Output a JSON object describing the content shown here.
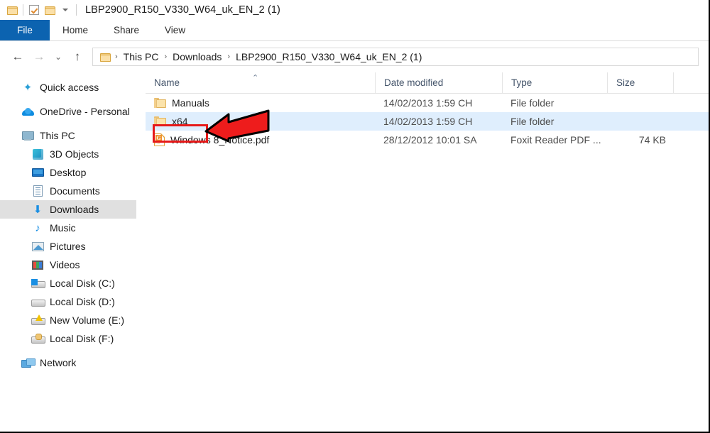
{
  "window": {
    "title": "LBP2900_R150_V330_W64_uk_EN_2 (1)",
    "quick_access_icons": [
      "folder-icon",
      "properties-checkbox-icon",
      "new-folder-icon",
      "customize-chevron-icon"
    ]
  },
  "ribbon": {
    "tabs": [
      {
        "label": "File",
        "active": true
      },
      {
        "label": "Home",
        "active": false
      },
      {
        "label": "Share",
        "active": false
      },
      {
        "label": "View",
        "active": false
      }
    ]
  },
  "navbar": {
    "back": "←",
    "forward": "→",
    "recent": "⌄",
    "up": "↑",
    "breadcrumb": [
      "This PC",
      "Downloads",
      "LBP2900_R150_V330_W64_uk_EN_2 (1)"
    ],
    "separator": "›"
  },
  "sidebar": {
    "items": [
      {
        "label": "Quick access",
        "icon": "star-icon",
        "indent": 0,
        "selected": false
      },
      {
        "label": "OneDrive - Personal",
        "icon": "onedrive-cloud-icon",
        "indent": 0,
        "selected": false
      },
      {
        "label": "This PC",
        "icon": "this-pc-icon",
        "indent": 0,
        "selected": false
      },
      {
        "label": "3D Objects",
        "icon": "3d-objects-icon",
        "indent": 1,
        "selected": false
      },
      {
        "label": "Desktop",
        "icon": "desktop-icon",
        "indent": 1,
        "selected": false
      },
      {
        "label": "Documents",
        "icon": "documents-icon",
        "indent": 1,
        "selected": false
      },
      {
        "label": "Downloads",
        "icon": "downloads-icon",
        "indent": 1,
        "selected": true
      },
      {
        "label": "Music",
        "icon": "music-icon",
        "indent": 1,
        "selected": false
      },
      {
        "label": "Pictures",
        "icon": "pictures-icon",
        "indent": 1,
        "selected": false
      },
      {
        "label": "Videos",
        "icon": "videos-icon",
        "indent": 1,
        "selected": false
      },
      {
        "label": "Local Disk (C:)",
        "icon": "local-disk-windows-icon",
        "indent": 1,
        "selected": false
      },
      {
        "label": "Local Disk (D:)",
        "icon": "local-disk-icon",
        "indent": 1,
        "selected": false
      },
      {
        "label": "New Volume (E:)",
        "icon": "local-disk-warning-icon",
        "indent": 1,
        "selected": false
      },
      {
        "label": "Local Disk (F:)",
        "icon": "local-disk-shared-icon",
        "indent": 1,
        "selected": false
      },
      {
        "label": "Network",
        "icon": "network-icon",
        "indent": 0,
        "selected": false
      }
    ]
  },
  "filelist": {
    "columns": [
      {
        "key": "name",
        "label": "Name",
        "sorted": "ascending",
        "sort_glyph": "⌃"
      },
      {
        "key": "date",
        "label": "Date modified"
      },
      {
        "key": "type",
        "label": "Type"
      },
      {
        "key": "size",
        "label": "Size"
      }
    ],
    "rows": [
      {
        "name": "Manuals",
        "date": "14/02/2013 1:59 CH",
        "type": "File folder",
        "size": "",
        "icon": "folder-icon",
        "selected": false
      },
      {
        "name": "x64",
        "date": "14/02/2013 1:59 CH",
        "type": "File folder",
        "size": "",
        "icon": "folder-icon",
        "selected": true
      },
      {
        "name": "Windows 8_Notice.pdf",
        "date": "28/12/2012 10:01 SA",
        "type": "Foxit Reader PDF ...",
        "size": "74 KB",
        "icon": "pdf-file-icon",
        "selected": false
      }
    ]
  },
  "annotations": {
    "highlight_box": {
      "target": "x64",
      "color": "#e61919"
    },
    "arrow": {
      "points_to": "x64",
      "color": "#ee1c1c",
      "outline": "#000000"
    }
  },
  "colors": {
    "file_tab_blue": "#0c63b0",
    "row_selected": "#dfeefd",
    "sidebar_selected": "#e0e0e0",
    "header_text": "#44546a",
    "annotation_red": "#e61919"
  }
}
